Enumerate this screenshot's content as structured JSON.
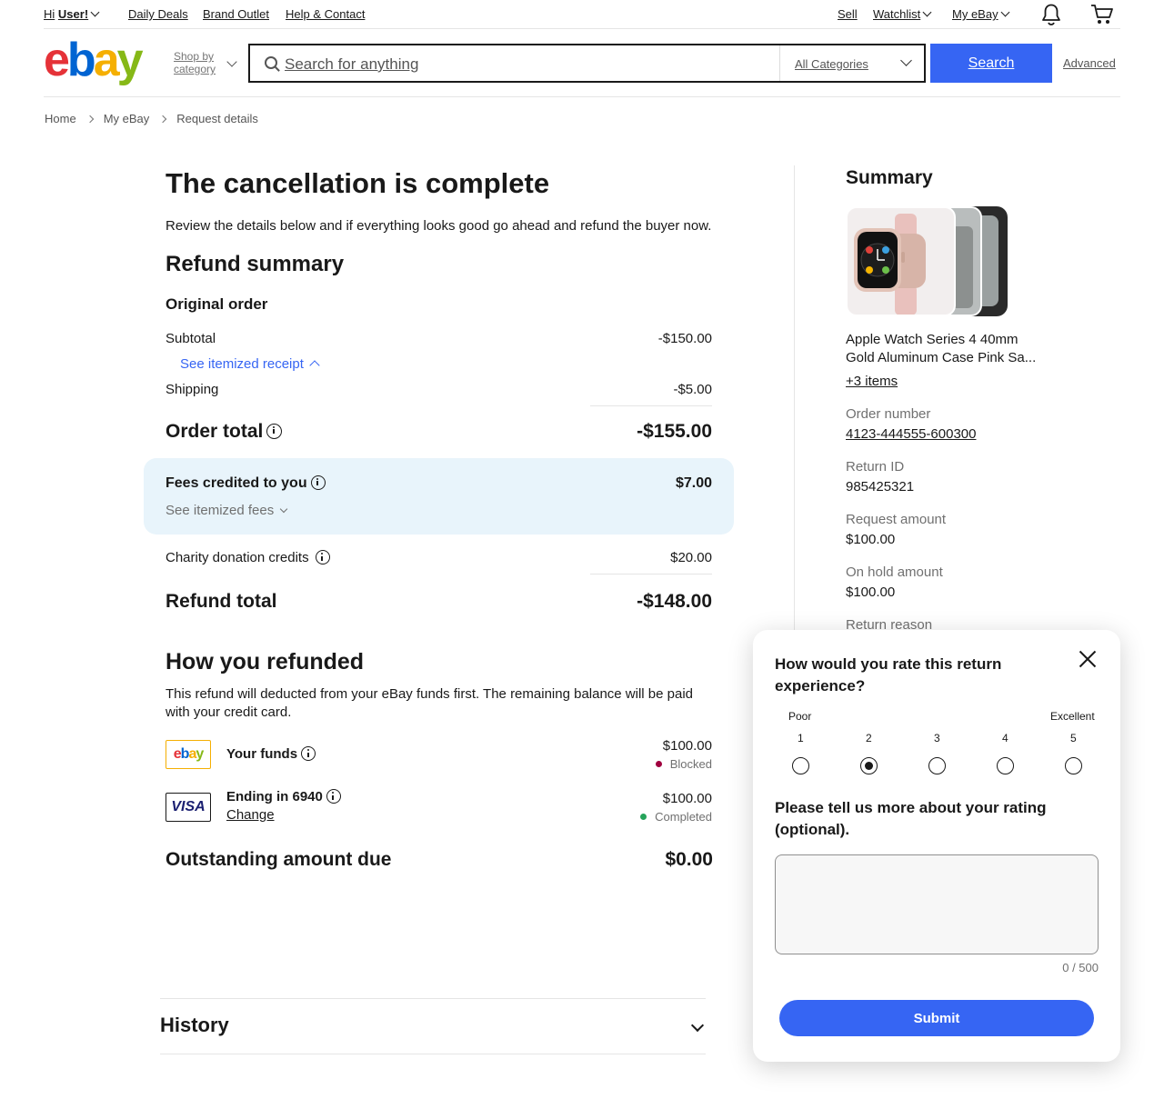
{
  "topnav": {
    "greeting_prefix": "Hi",
    "user": "User!",
    "daily_deals": "Daily Deals",
    "brand_outlet": "Brand Outlet",
    "help_contact": "Help & Contact",
    "sell": "Sell",
    "watchlist": "Watchlist",
    "my_ebay": "My eBay"
  },
  "header": {
    "shop_by_category": [
      "Shop by",
      "category"
    ],
    "search_placeholder": "Search for anything",
    "category_select": "All Categories",
    "search_button": "Search",
    "advanced": "Advanced"
  },
  "breadcrumb": [
    "Home",
    "My eBay",
    "Request details"
  ],
  "main": {
    "title": "The cancellation is complete",
    "intro": "Review the details below and if everything looks good go ahead and refund the buyer now.",
    "refund_summary": "Refund summary",
    "original_order": "Original order",
    "subtotal_label": "Subtotal",
    "subtotal_value": "-$150.00",
    "itemized_receipt": "See itemized receipt",
    "shipping_label": "Shipping",
    "shipping_value": "-$5.00",
    "order_total_label": "Order total",
    "order_total_value": "-$155.00",
    "fees_label": "Fees credited to you",
    "fees_value": "$7.00",
    "itemized_fees": "See itemized fees",
    "charity_label": "Charity donation credits",
    "charity_value": "$20.00",
    "refund_total_label": "Refund total",
    "refund_total_value": "-$148.00",
    "how_refunded": "How you refunded",
    "how_refunded_text": "This refund will deducted from your eBay funds first. The remaining balance will be paid with your credit card.",
    "payments": [
      {
        "logo": "ebay",
        "label": "Your funds",
        "amount": "$100.00",
        "status": "Blocked",
        "status_color": "#a0003f"
      },
      {
        "logo": "VISA",
        "label": "Ending in 6940",
        "link": "Change",
        "amount": "$100.00",
        "status": "Completed",
        "status_color": "#25a35a"
      }
    ],
    "outstanding_label": "Outstanding amount due",
    "outstanding_value": "$0.00",
    "history": "History"
  },
  "summary": {
    "title": "Summary",
    "item_title_1": "Apple Watch Series 4 40mm",
    "item_title_2": "Gold Aluminum Case Pink Sa...",
    "more_items": "+3 items",
    "order_number_label": "Order number",
    "order_number": "4123-444555-600300",
    "return_id_label": "Return ID",
    "return_id": "985425321",
    "request_amount_label": "Request amount",
    "request_amount": "$100.00",
    "on_hold_label": "On hold amount",
    "on_hold": "$100.00",
    "return_reason_label": "Return reason"
  },
  "feedback": {
    "question_1": "How would you rate this return",
    "question_2": "experience?",
    "poor": "Poor",
    "excellent": "Excellent",
    "scale": [
      "1",
      "2",
      "3",
      "4",
      "5"
    ],
    "selected": 2,
    "more_label_1": "Please tell us more about your rating",
    "more_label_2": "(optional).",
    "char_count": "0 / 500",
    "submit": "Submit"
  },
  "colors": {
    "accent": "#3665f3",
    "link": "#3665f3",
    "fees_bg": "#e8f4fb",
    "blocked": "#a0003f",
    "completed": "#25a35a"
  }
}
